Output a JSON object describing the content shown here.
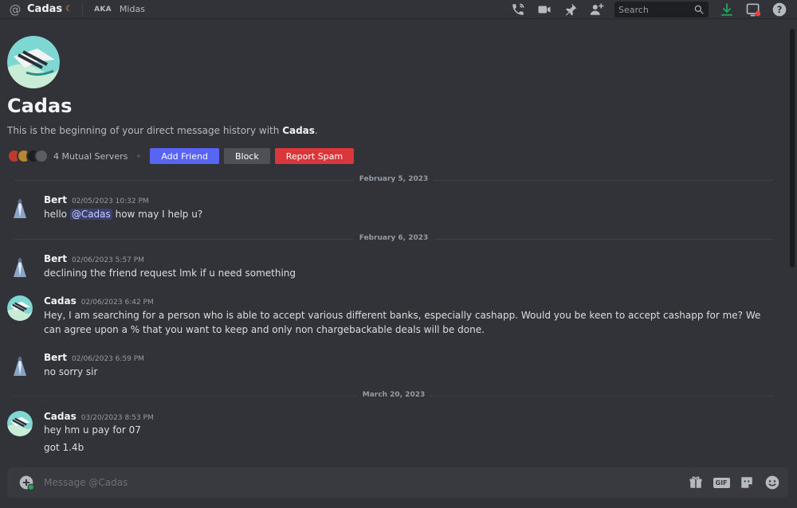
{
  "header": {
    "name": "Cadas",
    "aka_label": "AKA",
    "aka_name": "Midas",
    "search_placeholder": "Search"
  },
  "intro": {
    "name": "Cadas",
    "desc_prefix": "This is the beginning of your direct message history with ",
    "desc_name": "Cadas",
    "desc_suffix": ".",
    "mutual_servers": "4 Mutual Servers",
    "add_friend": "Add Friend",
    "block": "Block",
    "report_spam": "Report Spam"
  },
  "dividers": [
    "February 5, 2023",
    "February 6, 2023",
    "March 20, 2023"
  ],
  "messages": [
    {
      "author": "Bert",
      "timestamp": "02/05/2023 10:32 PM",
      "text_before": "hello ",
      "mention": "@Cadas",
      "text_after": " how may I help u?"
    },
    {
      "author": "Bert",
      "timestamp": "02/06/2023 5:57 PM",
      "text": "declining the friend request lmk if u need something"
    },
    {
      "author": "Cadas",
      "timestamp": "02/06/2023 6:42 PM",
      "text": "Hey, I am searching for a person who is able to accept various different banks, especially cashapp. Would you be keen to accept cashapp for me? We can agree upon a % that you want to keep and only non chargebackable deals will be done."
    },
    {
      "author": "Bert",
      "timestamp": "02/06/2023 6:59 PM",
      "text": "no sorry sir"
    },
    {
      "author": "Cadas",
      "timestamp": "03/20/2023 8:53 PM",
      "text": "hey hm u pay for 07",
      "text2": "got 1.4b"
    }
  ],
  "composer": {
    "placeholder": "Message @Cadas",
    "gif_label": "GIF"
  },
  "colors": {
    "background": "#313338",
    "blurple": "#5865f2",
    "danger": "#da373c",
    "download_green": "#23a55a"
  },
  "icons": [
    "at-icon",
    "moon-icon",
    "phone-call-icon",
    "video-call-icon",
    "pin-icon",
    "add-friend-icon",
    "search-icon",
    "download-icon",
    "inbox-icon",
    "help-icon",
    "upload-plus-icon",
    "gift-icon",
    "gif-icon",
    "sticker-icon",
    "emoji-icon"
  ]
}
